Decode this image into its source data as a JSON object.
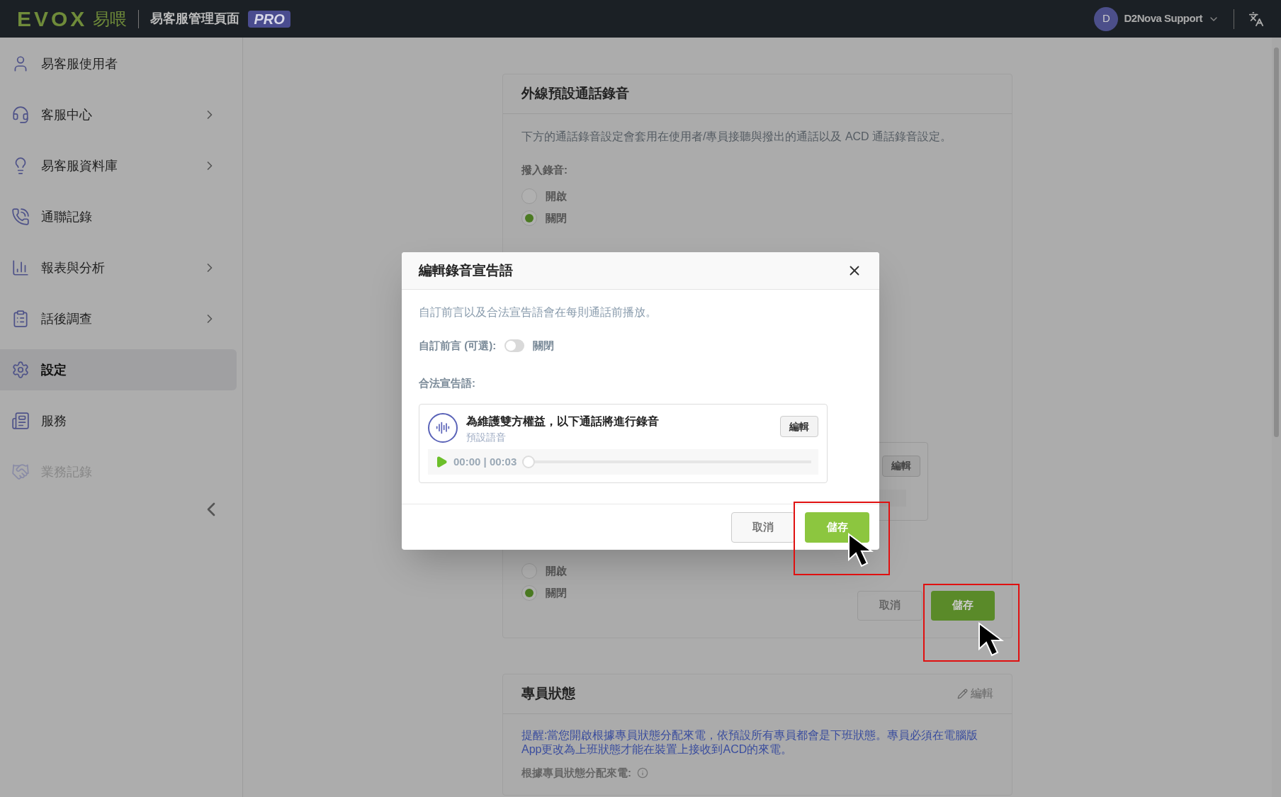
{
  "header": {
    "logo_text": "EVOX",
    "logo_cjk": "易喂",
    "app_title": "易客服管理頁面",
    "badge": "PRO",
    "user": {
      "avatar_letter": "D",
      "name": "D2Nova Support"
    }
  },
  "sidebar": {
    "items": [
      {
        "label": "易客服使用者",
        "has_children": false,
        "selected": false,
        "disabled": false
      },
      {
        "label": "客服中心",
        "has_children": true,
        "selected": false,
        "disabled": false
      },
      {
        "label": "易客服資料庫",
        "has_children": true,
        "selected": false,
        "disabled": false
      },
      {
        "label": "通聯記錄",
        "has_children": false,
        "selected": false,
        "disabled": false
      },
      {
        "label": "報表與分析",
        "has_children": true,
        "selected": false,
        "disabled": false
      },
      {
        "label": "話後調查",
        "has_children": true,
        "selected": false,
        "disabled": false
      },
      {
        "label": "設定",
        "has_children": false,
        "selected": true,
        "disabled": false
      },
      {
        "label": "服務",
        "has_children": false,
        "selected": false,
        "disabled": false
      },
      {
        "label": "業務記錄",
        "has_children": false,
        "selected": false,
        "disabled": true
      }
    ]
  },
  "recording_card": {
    "title": "外線預設通話錄音",
    "description": "下方的通話錄音設定會套用在使用者/專員接聽與撥出的通話以及 ACD 通話錄音設定。",
    "inbound": {
      "label": "撥入錄音:",
      "options": [
        {
          "label": "開啟",
          "selected": false
        },
        {
          "label": "關閉",
          "selected": true
        }
      ]
    },
    "announcement_edit_button": "編輯",
    "lower_options": [
      {
        "label": "開啟",
        "selected": false
      },
      {
        "label": "關閉",
        "selected": true
      }
    ],
    "cancel_button": "取消",
    "save_button": "儲存"
  },
  "modal": {
    "title": "編輯錄音宣告語",
    "description": "自訂前言以及合法宣告語會在每則通話前播放。",
    "custom_intro": {
      "label": "自訂前言 (可選):",
      "on": false,
      "state_text": "關閉"
    },
    "legal_label": "合法宣告語:",
    "announcement": {
      "text": "為維護雙方權益，以下通話將進行錄音",
      "subtitle": "預設語音",
      "edit_button": "編輯",
      "time": "00:00 | 00:03",
      "level": 0
    },
    "cancel_button": "取消",
    "save_button": "儲存"
  },
  "agent_card": {
    "title": "專員狀態",
    "edit_link": "編輯",
    "notice": "提醒:當您開啟根據專員狀態分配來電，依預設所有專員都會是下班狀態。專員必須在電腦版App更改為上班狀態才能在裝置上接收到ACD的來電。",
    "field_label": "根據專員狀態分配來電:"
  }
}
